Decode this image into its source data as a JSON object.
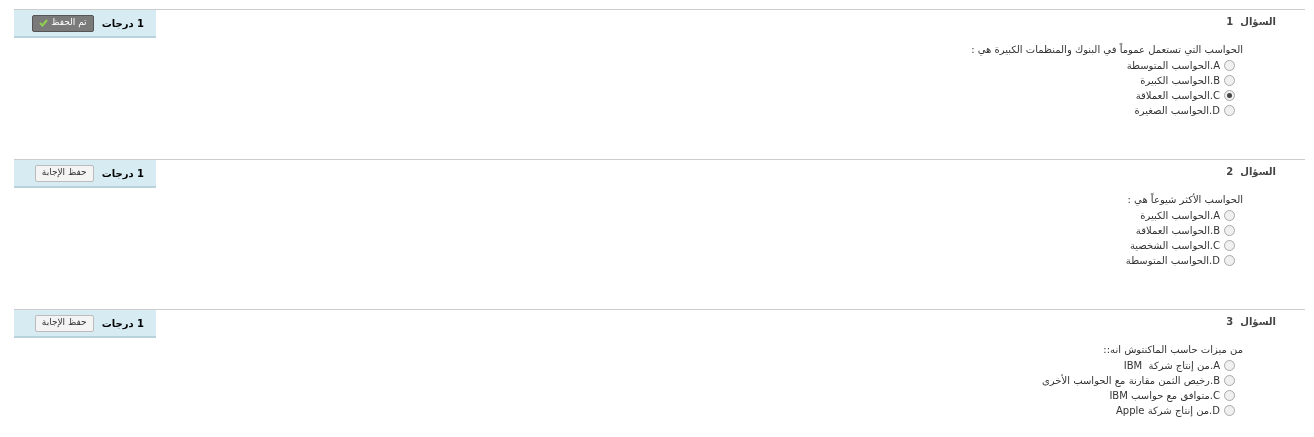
{
  "questions": [
    {
      "title": "السؤال",
      "number": "1",
      "points": "1 درجات",
      "button": {
        "label": "تم الحفظ",
        "saved": true
      },
      "text": "الحواسب التي تستعمل عموماً في البنوك والمنظمات الكبيرة هي :",
      "options": [
        {
          "label": "A.الحواسب المتوسطة",
          "selected": false
        },
        {
          "label": "B.الحواسب الكبيرة",
          "selected": false
        },
        {
          "label": "C.الحواسب العملاقة",
          "selected": true
        },
        {
          "label": "D.الحواسب الصغيرة",
          "selected": false
        }
      ]
    },
    {
      "title": "السؤال",
      "number": "2",
      "points": "1 درجات",
      "button": {
        "label": "حفظ الإجابة",
        "saved": false
      },
      "text": "الحواسب الأكثر شيوعاً هي :",
      "options": [
        {
          "label": "A.الحواسب الكبيرة",
          "selected": false
        },
        {
          "label": "B.الحواسب العملاقة",
          "selected": false
        },
        {
          "label": "C.الحواسب الشخصية",
          "selected": false
        },
        {
          "label": "D.الحواسب المتوسطة",
          "selected": false
        }
      ]
    },
    {
      "title": "السؤال",
      "number": "3",
      "points": "1 درجات",
      "button": {
        "label": "حفظ الإجابة",
        "saved": false
      },
      "text": "من ميزات حاسب الماكنتوش انه::",
      "options": [
        {
          "label": "A.من إنتاج شركة  IBM",
          "selected": false
        },
        {
          "label": "B.رخيص الثمن مقارنة مع الحواسب الأخرى",
          "selected": false
        },
        {
          "label": "C.متوافق مع حواسب IBM",
          "selected": false
        },
        {
          "label": "D.من إنتاج شركة Apple",
          "selected": false
        }
      ]
    }
  ]
}
